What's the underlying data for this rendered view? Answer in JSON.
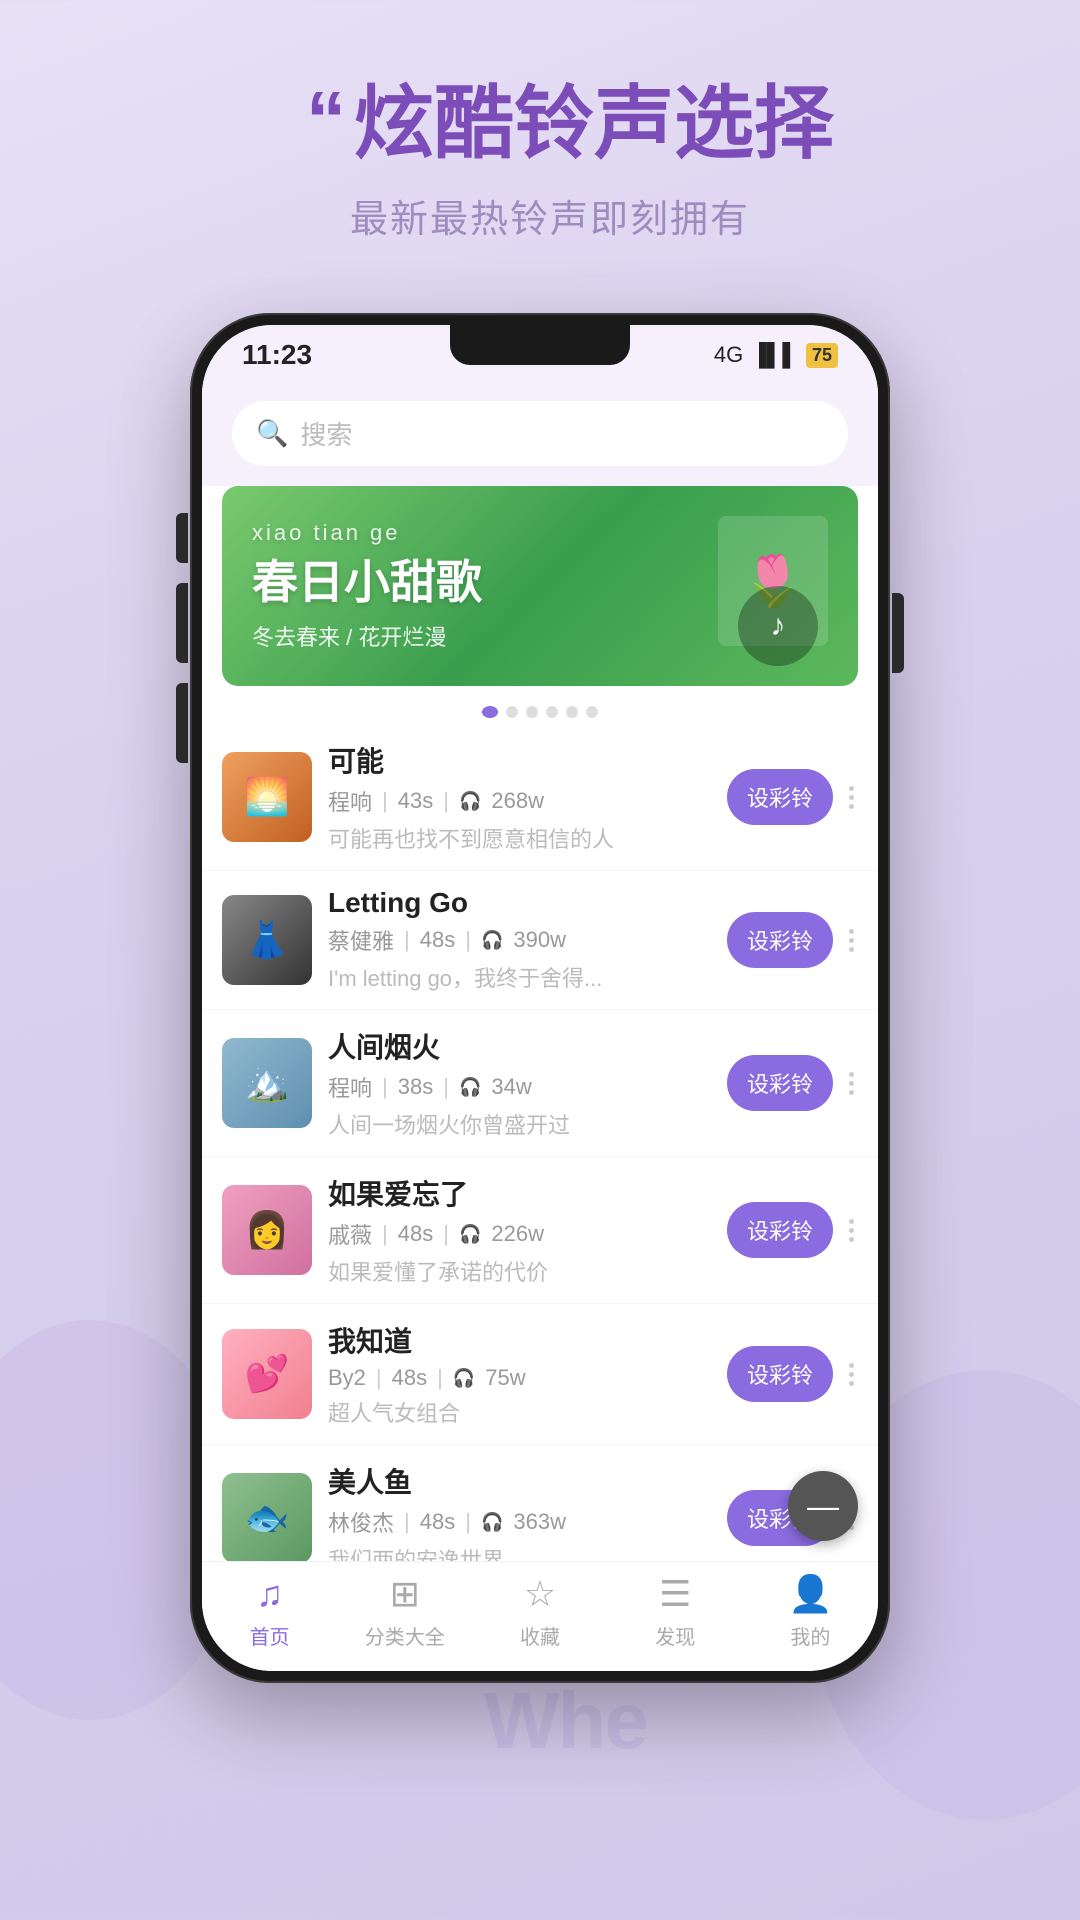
{
  "background": {
    "color_start": "#e8e0f5",
    "color_end": "#cfc8e8"
  },
  "header": {
    "quote_mark": "“",
    "title": "炫酷铃声选择",
    "subtitle": "最新最热铃声即刻拥有"
  },
  "status_bar": {
    "time": "11:23",
    "signal1": "4G",
    "signal2": "all",
    "battery": "75"
  },
  "search": {
    "placeholder": "搜索"
  },
  "banner": {
    "title_main": "春日小甜歌",
    "title_small": "xiao tian ge",
    "subtitle": "冬去春来 / 花开烂漫",
    "dots": [
      true,
      false,
      false,
      false,
      false,
      false
    ]
  },
  "songs": [
    {
      "id": 1,
      "title": "可能",
      "artist": "程响",
      "duration": "43s",
      "plays": "268w",
      "desc": "可能再也找不到愿意相信的人",
      "btn": "设彩铃",
      "thumb_class": "thumb-1"
    },
    {
      "id": 2,
      "title": "Letting Go",
      "artist": "蔡健雅",
      "duration": "48s",
      "plays": "390w",
      "desc": "I'm letting go，我终于舍得...",
      "btn": "设彩铃",
      "thumb_class": "thumb-2"
    },
    {
      "id": 3,
      "title": "人间烟火",
      "artist": "程响",
      "duration": "38s",
      "plays": "34w",
      "desc": "人间一场烟火你曾盛开过",
      "btn": "设彩铃",
      "thumb_class": "thumb-3"
    },
    {
      "id": 4,
      "title": "如果爱忘了",
      "artist": "戚薇",
      "duration": "48s",
      "plays": "226w",
      "desc": "如果爱懂了承诺的代价",
      "btn": "设彩铃",
      "thumb_class": "thumb-4"
    },
    {
      "id": 5,
      "title": "我知道",
      "artist": "By2",
      "duration": "48s",
      "plays": "75w",
      "desc": "超人气女组合",
      "btn": "设彩铃",
      "thumb_class": "thumb-5"
    },
    {
      "id": 6,
      "title": "美人鱼",
      "artist": "林俊杰",
      "duration": "48s",
      "plays": "363w",
      "desc": "我们两的安逸世界",
      "btn": "设彩铃",
      "thumb_class": "thumb-6"
    }
  ],
  "bottom_nav": [
    {
      "icon": "♪",
      "label": "首页",
      "active": true
    },
    {
      "icon": "⊞",
      "label": "分类大全",
      "active": false
    },
    {
      "icon": "☆",
      "label": "收藏",
      "active": false
    },
    {
      "icon": "≡",
      "label": "发现",
      "active": false
    },
    {
      "icon": "👤",
      "label": "我的",
      "active": false
    }
  ],
  "float_btn": {
    "icon": "—",
    "label": "float"
  },
  "whe_watermark": "Whe"
}
